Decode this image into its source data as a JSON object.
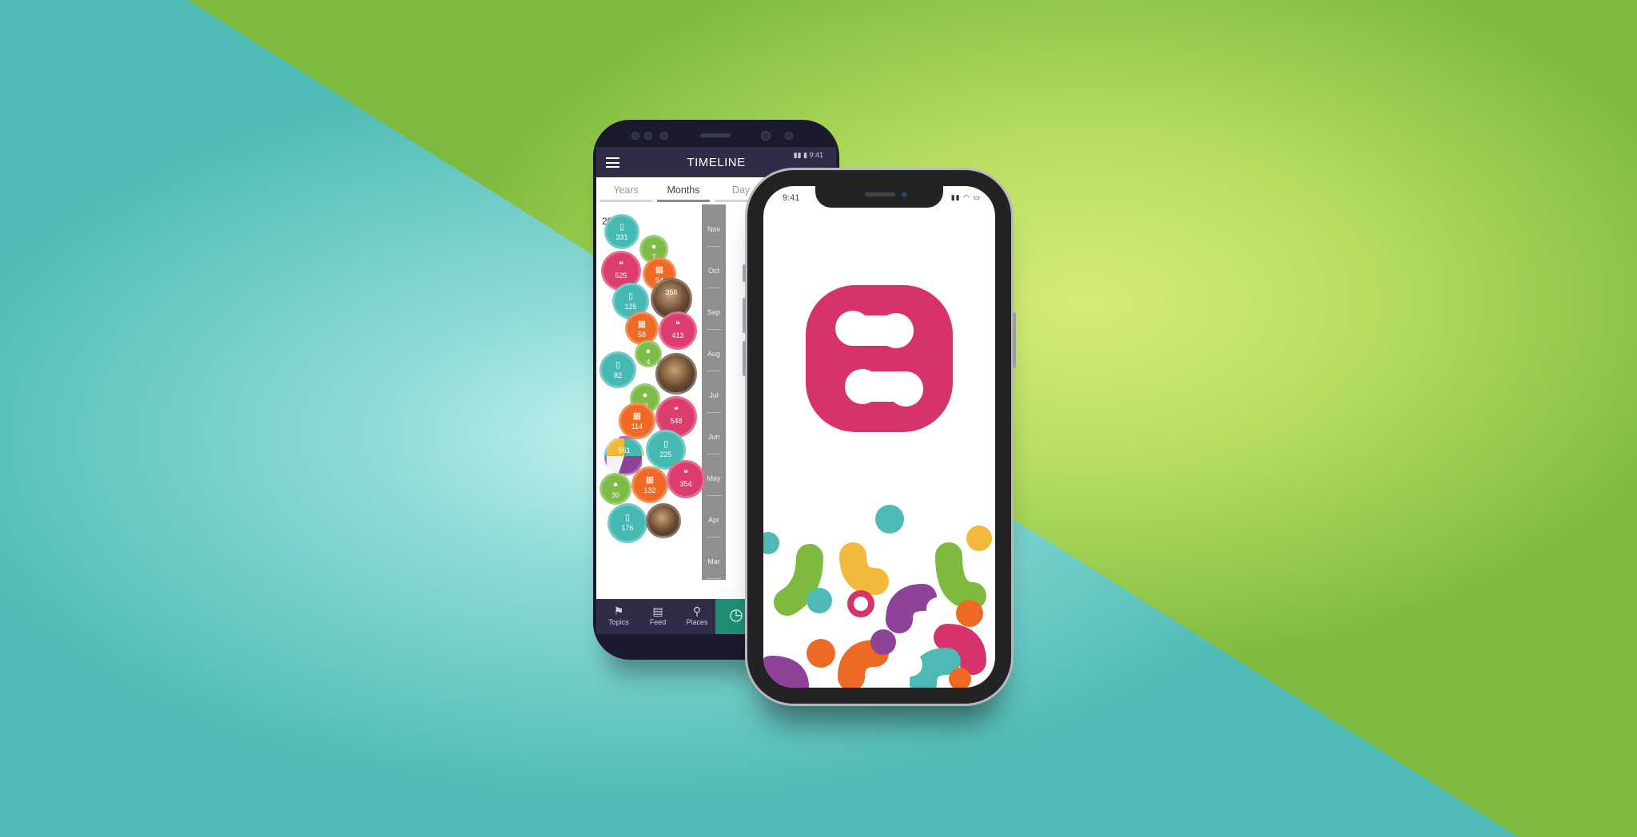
{
  "colors": {
    "teal": "#4ebab5",
    "green": "#7dba3e",
    "brand_pink": "#d6336c",
    "orange": "#ec6a23",
    "purple": "#8e4298",
    "yellow": "#f3b93a",
    "bubble_teal": "#46b9b3",
    "bubble_pink": "#dc3d6e",
    "bubble_green": "#7dbd45",
    "bubble_orange": "#ef6a25",
    "app_bar": "#2f2c48"
  },
  "android": {
    "status_time": "9:41",
    "title": "TIMELINE",
    "tabs": [
      "Years",
      "Months",
      "Day"
    ],
    "active_tab": "Months",
    "year": "2017",
    "months": [
      "Nov",
      "Oct",
      "Sep",
      "Aug",
      "Jul",
      "Jun",
      "May",
      "Apr",
      "Mar"
    ],
    "bubbles": [
      {
        "icon": "document-icon",
        "glyph": "▯",
        "value": "331",
        "color": "teal"
      },
      {
        "icon": "person-icon",
        "glyph": "●",
        "value": "7",
        "color": "green"
      },
      {
        "icon": "comment-icon",
        "glyph": "❝",
        "value": "525",
        "color": "pink"
      },
      {
        "icon": "calendar-icon",
        "glyph": "▦",
        "value": "54",
        "color": "orange"
      },
      {
        "icon": "document-icon",
        "glyph": "▯",
        "value": "125",
        "color": "teal"
      },
      {
        "icon": "photo-icon",
        "glyph": "",
        "value": "356",
        "color": "photo"
      },
      {
        "icon": "calendar-icon",
        "glyph": "▦",
        "value": "58",
        "color": "orange"
      },
      {
        "icon": "comment-icon",
        "glyph": "❝",
        "value": "413",
        "color": "pink"
      },
      {
        "icon": "person-icon",
        "glyph": "●",
        "value": "4",
        "color": "green"
      },
      {
        "icon": "document-icon",
        "glyph": "▯",
        "value": "82",
        "color": "teal"
      },
      {
        "icon": "photo-icon",
        "glyph": "",
        "value": "",
        "color": "photo"
      },
      {
        "icon": "person-icon",
        "glyph": "●",
        "value": "11",
        "color": "green"
      },
      {
        "icon": "calendar-icon",
        "glyph": "▦",
        "value": "114",
        "color": "orange"
      },
      {
        "icon": "comment-icon",
        "glyph": "❝",
        "value": "548",
        "color": "pink"
      },
      {
        "icon": "pie-icon",
        "glyph": "",
        "value": "561",
        "color": "pie"
      },
      {
        "icon": "document-icon",
        "glyph": "▯",
        "value": "225",
        "color": "teal"
      },
      {
        "icon": "person-icon",
        "glyph": "●",
        "value": "30",
        "color": "green"
      },
      {
        "icon": "calendar-icon",
        "glyph": "▦",
        "value": "132",
        "color": "orange"
      },
      {
        "icon": "comment-icon",
        "glyph": "❝",
        "value": "354",
        "color": "pink"
      },
      {
        "icon": "document-icon",
        "glyph": "▯",
        "value": "176",
        "color": "teal"
      },
      {
        "icon": "photo-icon",
        "glyph": "",
        "value": "",
        "color": "photo"
      }
    ],
    "nav": [
      {
        "label": "Topics",
        "icon": "bookmark-icon",
        "glyph": "⚑"
      },
      {
        "label": "Feed",
        "icon": "feed-icon",
        "glyph": "▤"
      },
      {
        "label": "Places",
        "icon": "location-pin-icon",
        "glyph": "⚲"
      },
      {
        "label": "",
        "icon": "clock-icon",
        "glyph": "◷"
      }
    ]
  },
  "iphone": {
    "status_time": "9:41",
    "status_icons": "▮▮ ◠ ▭"
  }
}
